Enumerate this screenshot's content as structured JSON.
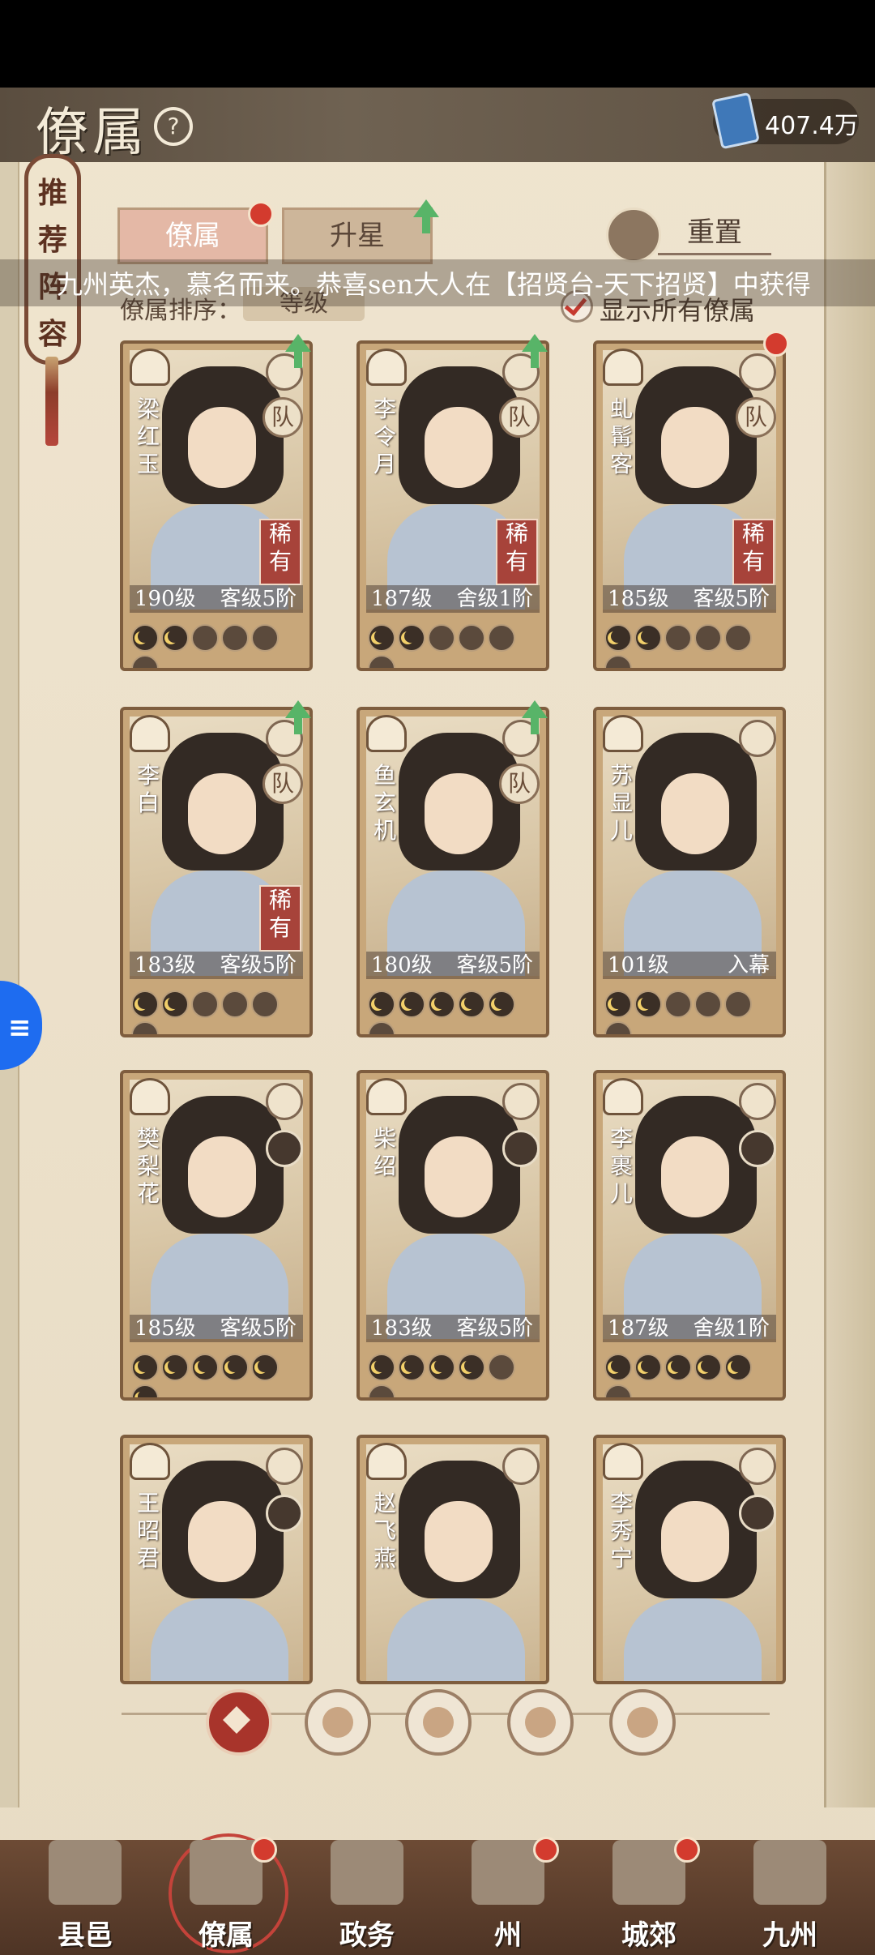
{
  "header": {
    "title": "僚属",
    "currency_value": "407.4万"
  },
  "side_banner": {
    "chars": [
      "推",
      "荐",
      "阵",
      "容"
    ]
  },
  "tabs": {
    "tab1": "僚属",
    "tab2": "升星",
    "reset": "重置"
  },
  "marquee": {
    "text": "九州英杰，慕名而来。恭喜sen大人在【招贤台-天下招贤】中获得"
  },
  "sort": {
    "label": "僚属排序：",
    "value": "等级"
  },
  "show_all": {
    "label": "显示所有僚属",
    "checked": true
  },
  "cards": [
    {
      "name": "梁红玉",
      "level": "190级",
      "rank": "客级5阶",
      "rare": "稀有",
      "team": "队",
      "stars": 2,
      "up": true
    },
    {
      "name": "李令月",
      "level": "187级",
      "rank": "舍级1阶",
      "rare": "稀有",
      "team": "队",
      "stars": 2,
      "up": true
    },
    {
      "name": "虬髯客",
      "level": "185级",
      "rank": "客级5阶",
      "rare": "稀有",
      "team": "队",
      "stars": 2,
      "dot": true
    },
    {
      "name": "李白",
      "level": "183级",
      "rank": "客级5阶",
      "rare": "稀有",
      "team": "队",
      "stars": 2,
      "up": true
    },
    {
      "name": "鱼玄机",
      "level": "180级",
      "rank": "客级5阶",
      "rare": "",
      "team": "队",
      "stars": 5,
      "up": true
    },
    {
      "name": "苏显儿",
      "level": "101级",
      "rank": "入幕",
      "rare": "",
      "team": "",
      "stars": 2
    },
    {
      "name": "樊梨花",
      "level": "185级",
      "rank": "客级5阶",
      "rare": "",
      "team": "",
      "stars": 6,
      "avatar": true
    },
    {
      "name": "柴绍",
      "level": "183级",
      "rank": "客级5阶",
      "rare": "",
      "team": "",
      "stars": 4,
      "avatar": true
    },
    {
      "name": "李裹儿",
      "level": "187级",
      "rank": "舍级1阶",
      "rare": "",
      "team": "",
      "stars": 5,
      "avatar": true
    },
    {
      "name": "王昭君",
      "level": "",
      "rank": "",
      "rare": "",
      "team": "",
      "stars": 0,
      "avatar": true
    },
    {
      "name": "赵飞燕",
      "level": "",
      "rank": "",
      "rare": "",
      "team": "",
      "stars": 0
    },
    {
      "name": "李秀宁",
      "level": "",
      "rank": "",
      "rare": "",
      "team": "",
      "stars": 0,
      "avatar": true
    }
  ],
  "filters": [
    "all-filter-icon",
    "bell-filter-icon",
    "cat-filter-icon",
    "fan-filter-icon",
    "lion-filter-icon"
  ],
  "nav": [
    {
      "label": "县邑",
      "dot": false
    },
    {
      "label": "僚属",
      "dot": true
    },
    {
      "label": "政务",
      "dot": false
    },
    {
      "label": "州",
      "dot": true
    },
    {
      "label": "城郊",
      "dot": true
    },
    {
      "label": "九州",
      "dot": false
    }
  ]
}
